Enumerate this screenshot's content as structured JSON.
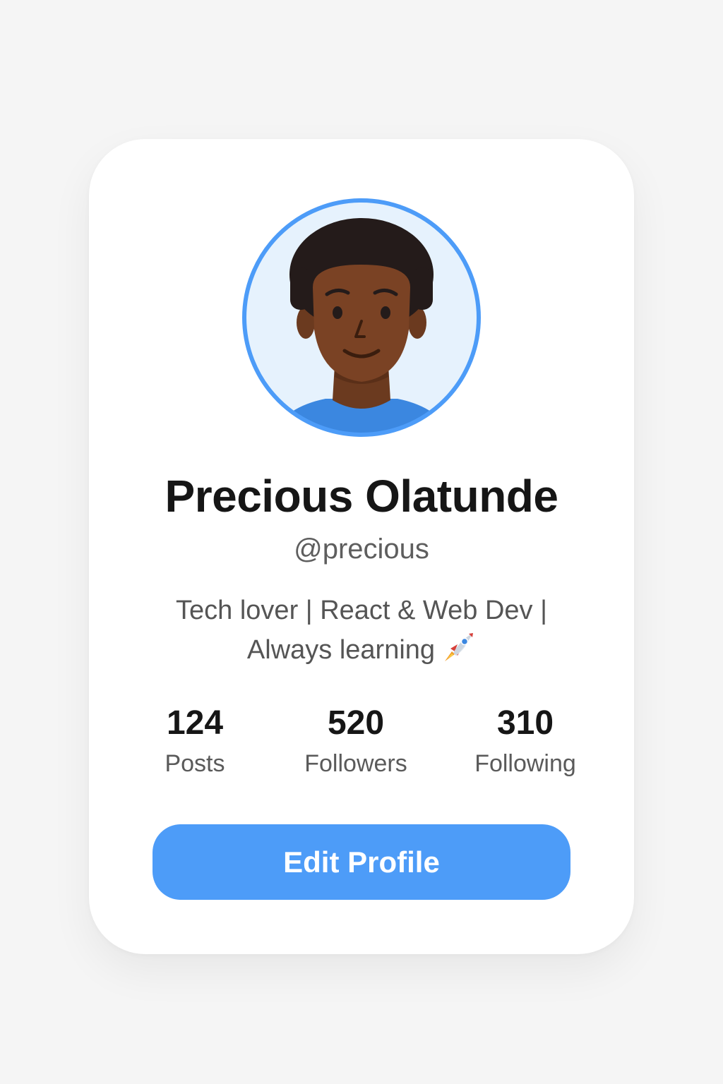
{
  "profile": {
    "name": "Precious Olatunde",
    "handle": "@precious",
    "bio_line1": "Tech lover | React & Web Dev |",
    "bio_line2": "Always learning",
    "bio_icon": "rocket-icon",
    "avatar_icon": "user-avatar-icon"
  },
  "stats": [
    {
      "value": "124",
      "label": "Posts"
    },
    {
      "value": "520",
      "label": "Followers"
    },
    {
      "value": "310",
      "label": "Following"
    }
  ],
  "actions": {
    "edit_label": "Edit Profile"
  },
  "colors": {
    "page_background": "#f5f5f5",
    "card_background": "#ffffff",
    "accent": "#4d9cf8",
    "avatar_ring": "#4d9cf8",
    "avatar_background": "#e6f2fd",
    "title_text": "#161616",
    "secondary_text": "#5e5e5e"
  }
}
